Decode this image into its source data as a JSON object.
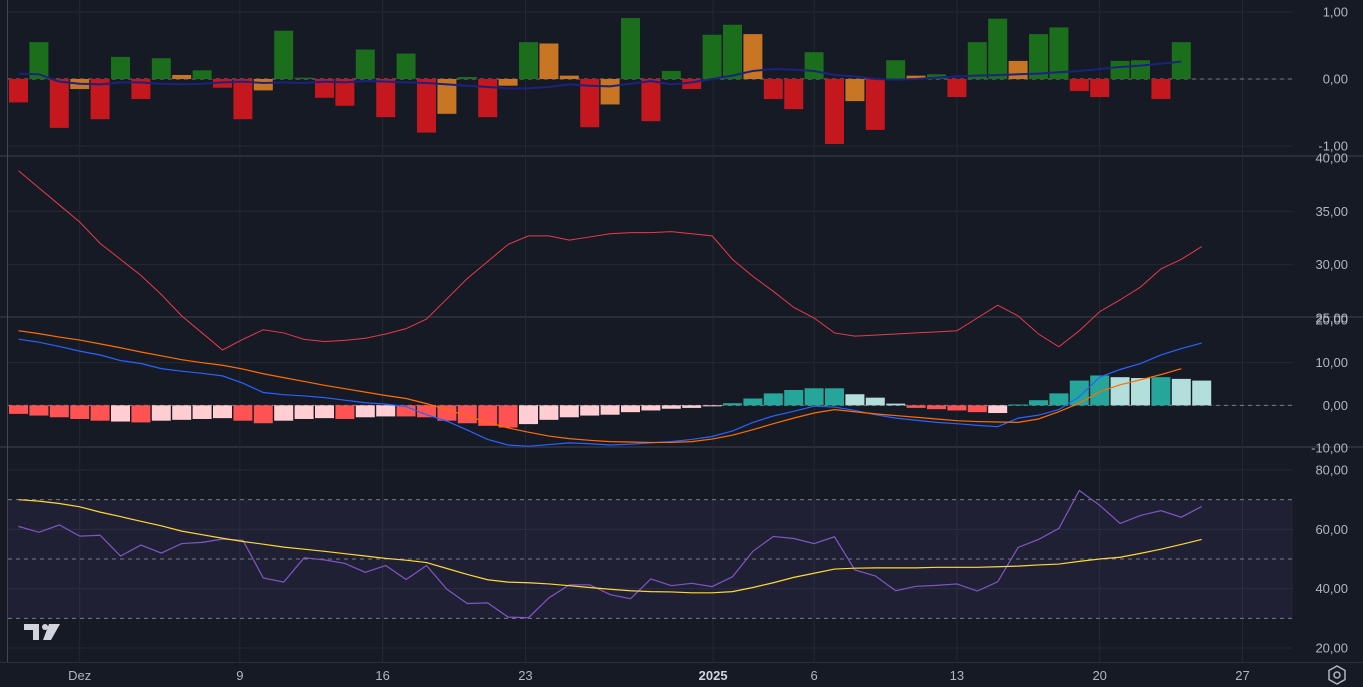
{
  "chart_data": [
    {
      "type": "bar",
      "panel": "bar-oscillator",
      "ylim": [
        -1.0,
        1.0
      ],
      "yticks": [
        "1,00",
        "0,00",
        "-1,00"
      ],
      "ytick_values": [
        1.0,
        0.0,
        -1.0
      ],
      "bars": [
        {
          "v": -0.35,
          "c": "red"
        },
        {
          "v": 0.55,
          "c": "green"
        },
        {
          "v": -0.73,
          "c": "red"
        },
        {
          "v": -0.15,
          "c": "orange"
        },
        {
          "v": -0.6,
          "c": "red"
        },
        {
          "v": 0.33,
          "c": "green"
        },
        {
          "v": -0.3,
          "c": "red"
        },
        {
          "v": 0.31,
          "c": "green"
        },
        {
          "v": 0.06,
          "c": "orange"
        },
        {
          "v": 0.13,
          "c": "green"
        },
        {
          "v": -0.13,
          "c": "red"
        },
        {
          "v": -0.6,
          "c": "red"
        },
        {
          "v": -0.17,
          "c": "orange"
        },
        {
          "v": 0.72,
          "c": "green"
        },
        {
          "v": 0.02,
          "c": "green"
        },
        {
          "v": -0.28,
          "c": "red"
        },
        {
          "v": -0.4,
          "c": "red"
        },
        {
          "v": 0.44,
          "c": "green"
        },
        {
          "v": -0.57,
          "c": "red"
        },
        {
          "v": 0.38,
          "c": "green"
        },
        {
          "v": -0.8,
          "c": "red"
        },
        {
          "v": -0.52,
          "c": "orange"
        },
        {
          "v": 0.03,
          "c": "green"
        },
        {
          "v": -0.57,
          "c": "red"
        },
        {
          "v": -0.1,
          "c": "orange"
        },
        {
          "v": 0.55,
          "c": "green"
        },
        {
          "v": 0.53,
          "c": "orange"
        },
        {
          "v": 0.05,
          "c": "orange"
        },
        {
          "v": -0.72,
          "c": "red"
        },
        {
          "v": -0.38,
          "c": "orange"
        },
        {
          "v": 0.91,
          "c": "green"
        },
        {
          "v": -0.63,
          "c": "red"
        },
        {
          "v": 0.12,
          "c": "green"
        },
        {
          "v": -0.15,
          "c": "red"
        },
        {
          "v": 0.66,
          "c": "green"
        },
        {
          "v": 0.81,
          "c": "green"
        },
        {
          "v": 0.67,
          "c": "orange"
        },
        {
          "v": -0.3,
          "c": "red"
        },
        {
          "v": -0.45,
          "c": "red"
        },
        {
          "v": 0.4,
          "c": "green"
        },
        {
          "v": -0.97,
          "c": "red"
        },
        {
          "v": -0.33,
          "c": "orange"
        },
        {
          "v": -0.76,
          "c": "red"
        },
        {
          "v": 0.28,
          "c": "green"
        },
        {
          "v": 0.05,
          "c": "orange"
        },
        {
          "v": 0.07,
          "c": "green"
        },
        {
          "v": -0.27,
          "c": "red"
        },
        {
          "v": 0.55,
          "c": "green"
        },
        {
          "v": 0.9,
          "c": "green"
        },
        {
          "v": 0.27,
          "c": "orange"
        },
        {
          "v": 0.67,
          "c": "green"
        },
        {
          "v": 0.77,
          "c": "green"
        },
        {
          "v": -0.18,
          "c": "red"
        },
        {
          "v": -0.27,
          "c": "red"
        },
        {
          "v": 0.27,
          "c": "green"
        },
        {
          "v": 0.28,
          "c": "green"
        },
        {
          "v": -0.3,
          "c": "red"
        },
        {
          "v": 0.55,
          "c": "green"
        }
      ],
      "signal_line": [
        0.08,
        0.07,
        -0.04,
        -0.07,
        -0.08,
        -0.05,
        -0.05,
        -0.07,
        -0.08,
        -0.07,
        -0.05,
        -0.04,
        -0.06,
        -0.05,
        -0.06,
        -0.04,
        -0.05,
        -0.03,
        -0.04,
        -0.05,
        -0.06,
        -0.08,
        -0.1,
        -0.12,
        -0.14,
        -0.14,
        -0.12,
        -0.08,
        -0.1,
        -0.11,
        -0.07,
        -0.03,
        -0.08,
        -0.05,
        0.0,
        0.05,
        0.12,
        0.15,
        0.14,
        0.12,
        0.06,
        0.04,
        0.0,
        -0.01,
        0.0,
        0.02,
        0.04,
        0.05,
        0.06,
        0.07,
        0.08,
        0.1,
        0.12,
        0.15,
        0.18,
        0.2,
        0.23,
        0.26
      ]
    },
    {
      "type": "line",
      "panel": "line-indicator",
      "ylim": [
        20.0,
        40.0
      ],
      "yticks": [
        "40,00",
        "35,00",
        "30,00",
        "25,00"
      ],
      "ytick_values": [
        40,
        35,
        30,
        25
      ],
      "series": [
        {
          "color": "#e83a4a",
          "values": [
            38.8,
            37.2,
            35.6,
            34.0,
            32.0,
            30.5,
            29.0,
            27.2,
            25.2,
            23.6,
            22.0,
            23.0,
            23.9,
            23.6,
            23.0,
            22.8,
            22.9,
            23.1,
            23.5,
            24.0,
            24.9,
            26.8,
            28.7,
            30.3,
            31.9,
            32.7,
            32.7,
            32.3,
            32.6,
            32.9,
            33.0,
            33.0,
            33.1,
            32.9,
            32.7,
            30.5,
            28.9,
            27.5,
            26.0,
            25.0,
            23.6,
            23.3,
            23.4,
            23.5,
            23.6,
            23.7,
            23.8,
            25.0,
            26.2,
            25.2,
            23.5,
            22.3,
            23.8,
            25.6,
            26.7,
            27.9,
            29.6,
            30.5,
            31.7
          ]
        }
      ]
    },
    {
      "type": "bar",
      "panel": "histogram-with-lines",
      "ylim": [
        -13.0,
        20.0
      ],
      "yticks": [
        "20,00",
        "10,00",
        "0,00",
        "-10,00"
      ],
      "ytick_values": [
        20,
        10,
        0,
        -10
      ],
      "histogram": [
        {
          "v": -2.0,
          "c": "strong-red"
        },
        {
          "v": -2.4,
          "c": "strong-red"
        },
        {
          "v": -2.8,
          "c": "strong-red"
        },
        {
          "v": -3.2,
          "c": "strong-red"
        },
        {
          "v": -3.6,
          "c": "strong-red"
        },
        {
          "v": -3.8,
          "c": "weak-red"
        },
        {
          "v": -4.0,
          "c": "strong-red"
        },
        {
          "v": -3.6,
          "c": "weak-red"
        },
        {
          "v": -3.4,
          "c": "weak-red"
        },
        {
          "v": -3.2,
          "c": "weak-red"
        },
        {
          "v": -3.0,
          "c": "weak-red"
        },
        {
          "v": -3.6,
          "c": "strong-red"
        },
        {
          "v": -4.2,
          "c": "strong-red"
        },
        {
          "v": -3.6,
          "c": "weak-red"
        },
        {
          "v": -3.2,
          "c": "weak-red"
        },
        {
          "v": -3.0,
          "c": "weak-red"
        },
        {
          "v": -3.2,
          "c": "strong-red"
        },
        {
          "v": -2.8,
          "c": "weak-red"
        },
        {
          "v": -2.6,
          "c": "weak-red"
        },
        {
          "v": -2.6,
          "c": "strong-red"
        },
        {
          "v": -2.8,
          "c": "strong-red"
        },
        {
          "v": -3.6,
          "c": "strong-red"
        },
        {
          "v": -4.2,
          "c": "strong-red"
        },
        {
          "v": -4.8,
          "c": "strong-red"
        },
        {
          "v": -5.2,
          "c": "strong-red"
        },
        {
          "v": -4.4,
          "c": "weak-red"
        },
        {
          "v": -3.4,
          "c": "weak-red"
        },
        {
          "v": -2.8,
          "c": "weak-red"
        },
        {
          "v": -2.4,
          "c": "weak-red"
        },
        {
          "v": -2.2,
          "c": "weak-red"
        },
        {
          "v": -1.6,
          "c": "weak-red"
        },
        {
          "v": -1.2,
          "c": "weak-red"
        },
        {
          "v": -0.8,
          "c": "weak-red"
        },
        {
          "v": -0.6,
          "c": "weak-red"
        },
        {
          "v": -0.2,
          "c": "weak-red"
        },
        {
          "v": 0.5,
          "c": "strong-teal"
        },
        {
          "v": 1.6,
          "c": "strong-teal"
        },
        {
          "v": 2.8,
          "c": "strong-teal"
        },
        {
          "v": 3.6,
          "c": "strong-teal"
        },
        {
          "v": 4.0,
          "c": "strong-teal"
        },
        {
          "v": 4.0,
          "c": "strong-teal"
        },
        {
          "v": 2.6,
          "c": "weak-teal"
        },
        {
          "v": 1.8,
          "c": "weak-teal"
        },
        {
          "v": 0.4,
          "c": "weak-teal"
        },
        {
          "v": -0.6,
          "c": "strong-red"
        },
        {
          "v": -0.9,
          "c": "strong-red"
        },
        {
          "v": -1.2,
          "c": "strong-red"
        },
        {
          "v": -1.6,
          "c": "strong-red"
        },
        {
          "v": -1.8,
          "c": "weak-red"
        },
        {
          "v": 0.2,
          "c": "strong-teal"
        },
        {
          "v": 1.2,
          "c": "strong-teal"
        },
        {
          "v": 2.8,
          "c": "strong-teal"
        },
        {
          "v": 5.8,
          "c": "strong-teal"
        },
        {
          "v": 7.0,
          "c": "strong-teal"
        },
        {
          "v": 6.6,
          "c": "weak-teal"
        },
        {
          "v": 6.4,
          "c": "weak-teal"
        },
        {
          "v": 6.6,
          "c": "strong-teal"
        },
        {
          "v": 6.2,
          "c": "weak-teal"
        },
        {
          "v": 5.8,
          "c": "weak-teal"
        }
      ],
      "series": [
        {
          "color": "#2962ff",
          "values": [
            15.5,
            14.8,
            13.8,
            12.7,
            11.8,
            10.5,
            9.8,
            8.6,
            8.0,
            7.5,
            6.9,
            5.2,
            3.0,
            2.5,
            2.2,
            1.8,
            1.2,
            0.6,
            0.3,
            -0.3,
            -2.2,
            -3.7,
            -5.8,
            -8.0,
            -9.3,
            -9.6,
            -9.2,
            -8.8,
            -9.0,
            -9.3,
            -9.1,
            -8.8,
            -8.5,
            -8.0,
            -7.3,
            -6.0,
            -4.0,
            -2.5,
            -1.4,
            -0.2,
            -0.4,
            -1.2,
            -2.2,
            -3.0,
            -3.5,
            -4.0,
            -4.3,
            -4.7,
            -5.0,
            -3.0,
            -2.3,
            -1.0,
            2.0,
            6.6,
            8.4,
            9.8,
            11.8,
            13.3,
            14.6
          ]
        },
        {
          "color": "#ff6d00",
          "values": [
            17.5,
            16.8,
            16.0,
            15.3,
            14.4,
            13.5,
            12.5,
            11.6,
            10.7,
            10.0,
            9.4,
            8.5,
            7.4,
            6.5,
            5.6,
            4.7,
            3.9,
            3.1,
            2.3,
            1.6,
            0.4,
            -1.0,
            -2.5,
            -4.0,
            -5.3,
            -6.3,
            -7.2,
            -7.8,
            -8.2,
            -8.5,
            -8.6,
            -8.7,
            -8.7,
            -8.5,
            -7.9,
            -7.0,
            -5.7,
            -4.3,
            -3.0,
            -1.8,
            -1.0,
            -1.5,
            -2.0,
            -2.4,
            -2.8,
            -3.2,
            -3.6,
            -3.8,
            -3.9,
            -4.0,
            -3.2,
            -1.5,
            0.5,
            3.2,
            4.8,
            6.0,
            7.2,
            8.6
          ]
        }
      ]
    },
    {
      "type": "line",
      "panel": "band-oscillator",
      "ylim": [
        18.5,
        85.0
      ],
      "yticks": [
        "80,00",
        "60,00",
        "40,00",
        "20,00"
      ],
      "ytick_values": [
        80,
        60,
        40,
        20
      ],
      "band": [
        30,
        70
      ],
      "midline": 50,
      "series": [
        {
          "color": "#7e57c2",
          "values": [
            61.0,
            59.0,
            61.5,
            57.7,
            58.0,
            51.0,
            54.7,
            52.0,
            55.2,
            55.6,
            56.7,
            56.3,
            43.6,
            42.2,
            50.4,
            49.7,
            48.5,
            45.5,
            47.8,
            43.1,
            47.8,
            39.8,
            35.0,
            35.2,
            30.4,
            30.2,
            36.9,
            41.3,
            41.3,
            38.0,
            36.6,
            43.3,
            41.0,
            41.8,
            40.7,
            44.0,
            52.6,
            57.6,
            56.9,
            55.2,
            57.5,
            46.3,
            44.3,
            39.3,
            40.8,
            41.1,
            41.6,
            39.2,
            42.3,
            53.9,
            56.6,
            60.3,
            73.1,
            68.1,
            62.0,
            64.7,
            66.3,
            64.1,
            67.7
          ]
        },
        {
          "color": "#fdd835",
          "values": [
            70.0,
            69.5,
            68.7,
            67.6,
            65.8,
            64.3,
            62.7,
            61.2,
            59.4,
            58.2,
            57.0,
            55.9,
            55.0,
            54.0,
            53.3,
            52.6,
            51.8,
            51.0,
            50.2,
            49.6,
            48.8,
            46.8,
            44.8,
            43.0,
            42.2,
            42.0,
            41.6,
            41.0,
            40.4,
            39.8,
            39.3,
            39.0,
            38.9,
            38.6,
            38.6,
            39.0,
            40.4,
            42.0,
            43.8,
            45.2,
            46.6,
            46.9,
            47.0,
            47.0,
            47.0,
            47.2,
            47.2,
            47.2,
            47.4,
            47.6,
            48.0,
            48.3,
            49.2,
            50.0,
            50.6,
            51.9,
            53.3,
            54.9,
            56.6
          ]
        }
      ]
    }
  ],
  "x_axis": {
    "ticks": [
      {
        "label": "Dez",
        "bold": false
      },
      {
        "label": "9",
        "bold": false
      },
      {
        "label": "16",
        "bold": false
      },
      {
        "label": "23",
        "bold": false
      },
      {
        "label": "2025",
        "bold": true
      },
      {
        "label": "6",
        "bold": false
      },
      {
        "label": "13",
        "bold": false
      },
      {
        "label": "20",
        "bold": false
      },
      {
        "label": "27",
        "bold": false
      }
    ]
  },
  "colors": {
    "background": "#161a25",
    "grid": "#242833",
    "separator": "#2a2e39",
    "green": "#1b6e1b",
    "red": "#c4171e",
    "orange": "#c87524",
    "strong_red": "#ff5252",
    "weak_red": "#ffcdd2",
    "strong_teal": "#26a69a",
    "weak_teal": "#b2dfdb",
    "signal_line": "#1a237e",
    "band_fill": "#7e57c2"
  },
  "icons": {
    "logo": "tradingview-logo",
    "settings": "settings-gear-icon"
  }
}
